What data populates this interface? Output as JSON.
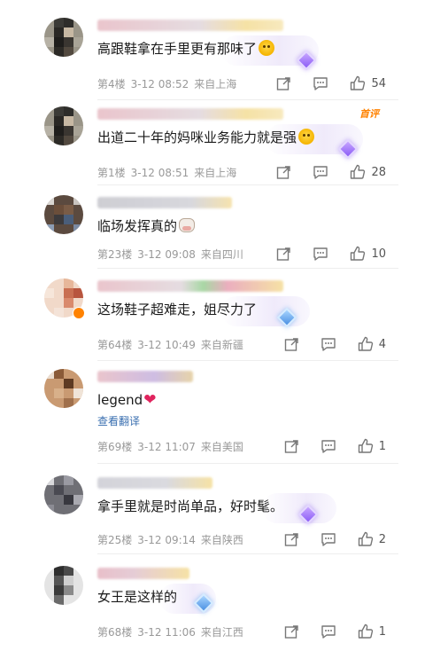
{
  "translate_label": "查看翻译",
  "hot_label": "首评",
  "comments": [
    {
      "text": "高跟鞋拿在手里更有那味了",
      "floor": "第4楼",
      "date": "3-12 08:52",
      "location": "来自上海",
      "likes": "54"
    },
    {
      "text": "出道二十年的妈咪业务能力就是强",
      "floor": "第1楼",
      "date": "3-12 08:51",
      "location": "来自上海",
      "likes": "28"
    },
    {
      "text": "临场发挥真的",
      "floor": "第23楼",
      "date": "3-12 09:08",
      "location": "来自四川",
      "likes": "10"
    },
    {
      "text": "这场鞋子超难走，姐尽力了",
      "floor": "第64楼",
      "date": "3-12 10:49",
      "location": "来自新疆",
      "likes": "4"
    },
    {
      "text": "legend",
      "floor": "第69楼",
      "date": "3-12 11:07",
      "location": "来自美国",
      "likes": "1"
    },
    {
      "text": "拿手里就是时尚单品，好时髦。",
      "floor": "第25楼",
      "date": "3-12 09:14",
      "location": "来自陕西",
      "likes": "2"
    },
    {
      "text": "女王是这样的",
      "floor": "第68楼",
      "date": "3-12 11:06",
      "location": "来自江西",
      "likes": "1"
    }
  ]
}
